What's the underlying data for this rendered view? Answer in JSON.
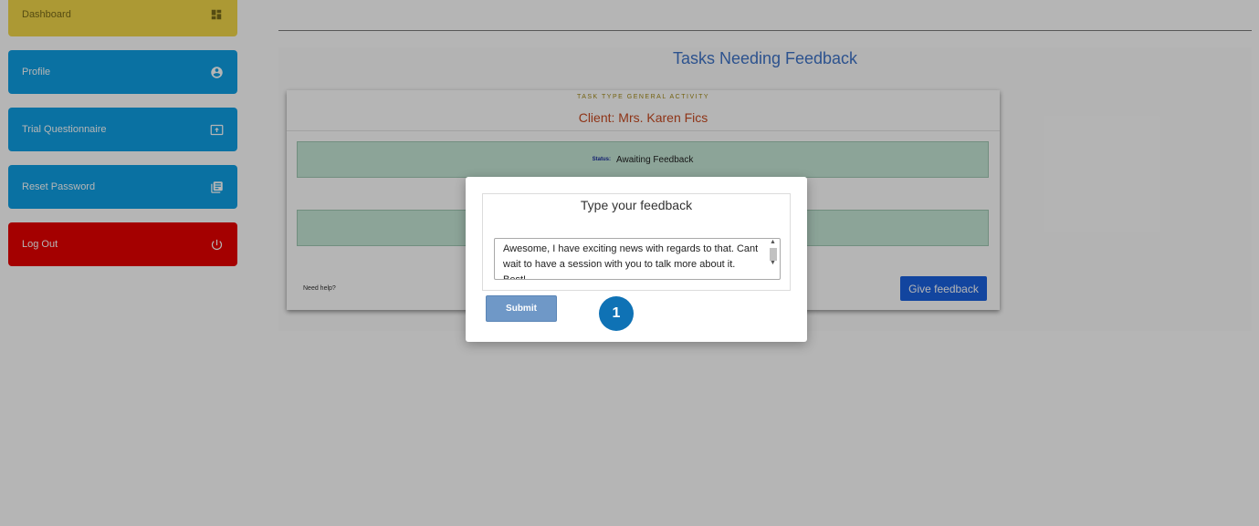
{
  "sidebar": {
    "items": [
      {
        "label": "Dashboard",
        "icon": "dashboard-icon",
        "color": "#f2d84a"
      },
      {
        "label": "Profile",
        "icon": "account-circle-icon",
        "color": "#0fa0e4"
      },
      {
        "label": "Trial Questionnaire",
        "icon": "upload-screen-icon",
        "color": "#0fa0e4"
      },
      {
        "label": "Reset Password",
        "icon": "library-books-icon",
        "color": "#0fa0e4"
      },
      {
        "label": "Log Out",
        "icon": "power-icon",
        "color": "#e80000"
      }
    ]
  },
  "main": {
    "title": "Tasks Needing Feedback",
    "task": {
      "type_label": "TASK TYPE GENERAL ACTIVITY",
      "client": "Client: Mrs. Karen Fics",
      "status_label": "Status:",
      "status_value": "Awaiting Feedback",
      "need_help": "Need help?",
      "give_feedback_label": "Give feedback"
    }
  },
  "modal": {
    "title": "Type your feedback",
    "feedback_value": "Awesome, I have exciting news with regards to that. Cant wait to have a session with you to talk more about it. Best!",
    "submit_label": "Submit",
    "step_badge": "1"
  }
}
